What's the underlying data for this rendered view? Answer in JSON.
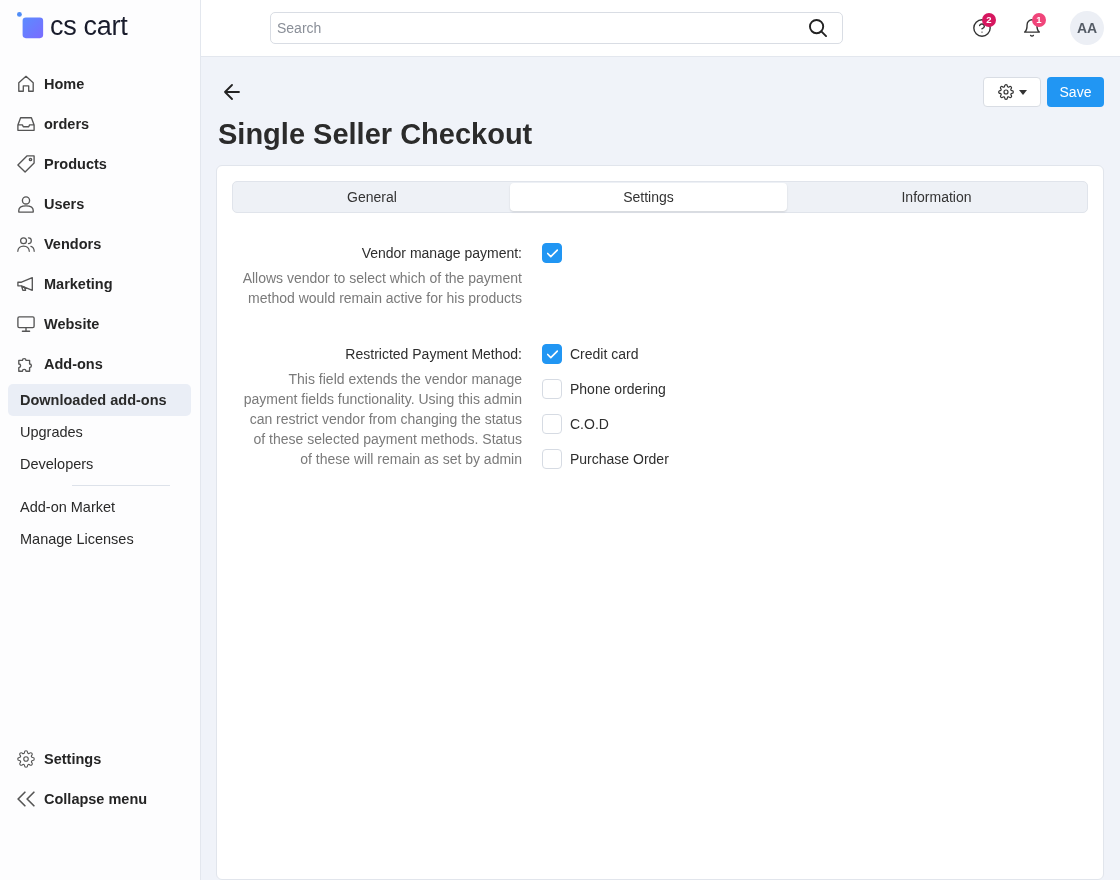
{
  "logo": {
    "text": "cs cart"
  },
  "sidebar": {
    "items": [
      {
        "label": "Home",
        "selected": false
      },
      {
        "label": "orders",
        "selected": false
      },
      {
        "label": "Products",
        "selected": false
      },
      {
        "label": "Users",
        "selected": false
      },
      {
        "label": "Vendors",
        "selected": false
      },
      {
        "label": "Marketing",
        "selected": false
      },
      {
        "label": "Website",
        "selected": false
      },
      {
        "label": "Add-ons",
        "selected": false,
        "children": [
          {
            "label": "Downloaded add-ons",
            "selected": true,
            "divider_before": false
          },
          {
            "label": "Upgrades",
            "selected": false,
            "divider_before": false
          },
          {
            "label": "Developers",
            "selected": false,
            "divider_before": false
          },
          {
            "label": "Add-on Market",
            "selected": false,
            "divider_before": true
          },
          {
            "label": "Manage Licenses",
            "selected": false,
            "divider_before": false
          }
        ]
      }
    ],
    "footer": [
      {
        "label": "Settings"
      },
      {
        "label": "Collapse menu"
      }
    ]
  },
  "topbar": {
    "search": {
      "placeholder": "Search"
    },
    "actions": [
      {
        "badge": "2",
        "color": "#d6175f"
      },
      {
        "badge": "1",
        "color": "#f0457a"
      }
    ],
    "avatar": "AA"
  },
  "page": {
    "title": "Single Seller Checkout",
    "save_button": "Save"
  },
  "tabs": [
    {
      "label": "General",
      "selected": false
    },
    {
      "label": "Settings",
      "selected": true
    },
    {
      "label": "Information",
      "selected": false
    }
  ],
  "settings": [
    {
      "kind": "checkbox",
      "label": "Vendor manage payment:",
      "description": "Allows vendor to select which of the payment method would remain active for his products",
      "checked": true
    },
    {
      "kind": "checklist",
      "label": "Restricted Payment Method:",
      "description": "This field extends the vendor manage payment fields functionality. Using this admin can restrict vendor from changing the status of these selected payment methods. Status of these will remain as set by admin",
      "options": [
        {
          "label": "Credit card",
          "checked": true
        },
        {
          "label": "Phone ordering",
          "checked": false
        },
        {
          "label": "C.O.D",
          "checked": false
        },
        {
          "label": "Purchase Order",
          "checked": false
        }
      ]
    }
  ]
}
